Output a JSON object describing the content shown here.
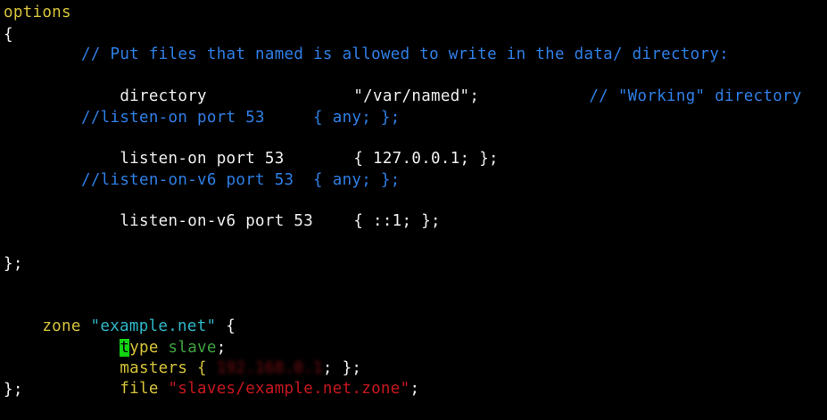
{
  "editor": {
    "l1": "options",
    "l2": "{",
    "l3": "// Put files that named is allowed to write in the data/ directory:",
    "l4_key": "directory",
    "l4_val": "\"/var/named\";",
    "l4_comment": "// \"Working\" directory",
    "l6": "//listen-on port 53     { any; };",
    "l7_key": "listen-on port 53",
    "l7_val": "{ 127.0.0.1; };",
    "l9": "//listen-on-v6 port 53  { any; };",
    "l10_key": "listen-on-v6 port 53",
    "l10_val": "{ ::1; };",
    "l13": "};",
    "l15_zone": "zone ",
    "l15_name": "\"example.net\"",
    "l15_brace": " {",
    "l16_cursor": "t",
    "l16_type": "ype",
    "l16_value": " slave",
    "l16_semi": ";",
    "l17_key": "masters { ",
    "l17_redacted": "192.168.0.1",
    "l17_end": "; };",
    "l18_key": "file ",
    "l18_value": "\"slaves/example.net.zone\"",
    "l18_semi": ";",
    "l19": "};"
  },
  "colors": {
    "keyword": "#d7c43a",
    "comment": "#2f7fe6",
    "string_zone": "#2fb7c9",
    "value_green": "#3fa33f",
    "string_red": "#c8171e",
    "cursor": "#13d413"
  }
}
